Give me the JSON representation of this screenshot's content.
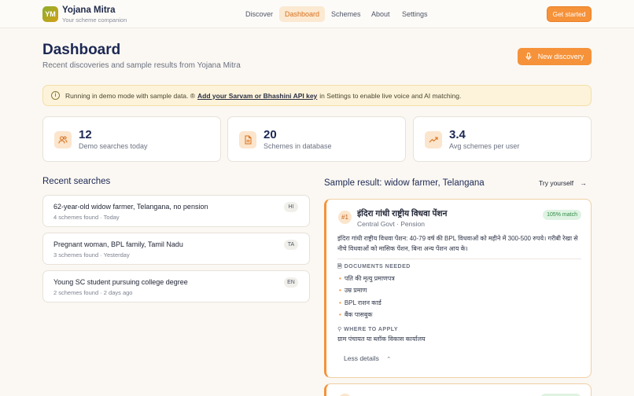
{
  "header": {
    "logo_text": "YM",
    "brand_name": "Yojana Mitra",
    "brand_tagline": "Your scheme companion",
    "nav": [
      "Discover",
      "Dashboard",
      "Schemes",
      "About",
      "Settings"
    ],
    "active_nav": "Dashboard",
    "cta_label": "Get started"
  },
  "page": {
    "title": "Dashboard",
    "subtitle": "Recent discoveries and sample results from Yojana Mitra",
    "new_button_label": "New discovery"
  },
  "banner": {
    "prefix": "Running in demo mode with sample data. ®",
    "link": "Add your Sarvam or Bhashini API key",
    "suffix": "in Settings to enable live voice and AI matching."
  },
  "stats": [
    {
      "value": "12",
      "label": "Demo searches today",
      "icon": "users-icon"
    },
    {
      "value": "20",
      "label": "Schemes in database",
      "icon": "file-icon"
    },
    {
      "value": "3.4",
      "label": "Avg schemes per user",
      "icon": "trending-up-icon"
    }
  ],
  "recent": {
    "title": "Recent searches",
    "items": [
      {
        "title": "62-year-old widow farmer, Telangana, no pension",
        "meta": "4 schemes found · Today",
        "lang": "HI"
      },
      {
        "title": "Pregnant woman, BPL family, Tamil Nadu",
        "meta": "3 schemes found · Yesterday",
        "lang": "TA"
      },
      {
        "title": "Young SC student pursuing college degree",
        "meta": "2 schemes found · 2 days ago",
        "lang": "EN"
      }
    ]
  },
  "sample": {
    "title": "Sample result: widow farmer, Telangana",
    "try_label": "Try yourself",
    "rank": "#1",
    "scheme_name": "इंदिरा गांधी राष्ट्रीय विधवा पेंशन",
    "scheme_meta": "Central Govt · Pension",
    "match": "105% match",
    "description": "इंदिरा गांधी राष्ट्रीय विधवा पेंशन: 40-79 वर्ष की BPL विधवाओं को महीने में 300-500 रुपये। गरीबी रेखा से नीचे विधवाओं को मासिक पेंशन, बिना अन्य पेंशन आय के।",
    "documents_heading": "DOCUMENTS NEEDED",
    "documents": [
      "पति की मृत्यु प्रमाणपत्र",
      "उम्र प्रमाण",
      "BPL राशन कार्ड",
      "बैंक पासबुक"
    ],
    "apply_heading": "WHERE TO APPLY",
    "apply_text": "ग्राम पंचायत या ब्लॉक विकास कार्यालय",
    "less_details_label": "Less details"
  },
  "colors": {
    "accent": "#f5923a",
    "accent_soft": "#fbe5cc",
    "match_green": "#2f8a45",
    "title_navy": "#1c2854"
  }
}
